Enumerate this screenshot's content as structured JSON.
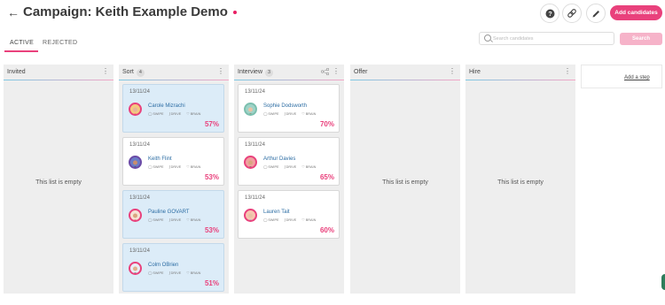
{
  "header": {
    "title": "Campaign: Keith Example Demo",
    "add_candidates_label": "Add candidates",
    "icons": [
      "help-icon",
      "link-icon",
      "edit-icon",
      "back-arrow-icon"
    ]
  },
  "tabs": [
    {
      "label": "ACTIVE",
      "active": true
    },
    {
      "label": "REJECTED",
      "active": false
    }
  ],
  "search": {
    "placeholder": "Search candidates",
    "button_label": "Search"
  },
  "colors": {
    "accent": "#e9417c",
    "link": "#2b6ca3",
    "column_bg": "#eeeeee",
    "card_blue": "#dcecf8"
  },
  "columns": [
    {
      "name": "Invited",
      "count": null,
      "empty_text": "This list is empty",
      "cards": []
    },
    {
      "name": "Sort",
      "count": "4",
      "empty_text": "",
      "cards": [
        {
          "date": "13/11/24",
          "name": "Carole Mizrachi",
          "tags": [
            "SWIPE",
            "DRIVE",
            "BRAIN"
          ],
          "score": "57%",
          "style": "blue"
        },
        {
          "date": "13/11/24",
          "name": "Keith Flint",
          "tags": [
            "SWIPE",
            "DRIVE",
            "BRAIN"
          ],
          "score": "53%",
          "style": "white"
        },
        {
          "date": "13/11/24",
          "name": "Pauline GOVART",
          "tags": [
            "SWIPE",
            "DRIVE",
            "BRAIN"
          ],
          "score": "53%",
          "style": "blue"
        },
        {
          "date": "13/11/24",
          "name": "Colm OBrien",
          "tags": [
            "SWIPE",
            "DRIVE",
            "BRAIN"
          ],
          "score": "51%",
          "style": "blue"
        }
      ]
    },
    {
      "name": "Interview",
      "count": "3",
      "empty_text": "",
      "cards": [
        {
          "date": "13/11/24",
          "name": "Sophie Dodsworth",
          "tags": [
            "SWIPE",
            "DRIVE",
            "BRAIN"
          ],
          "score": "70%",
          "style": "white"
        },
        {
          "date": "13/11/24",
          "name": "Arthur Davies",
          "tags": [
            "SWIPE",
            "DRIVE",
            "BRAIN"
          ],
          "score": "65%",
          "style": "white"
        },
        {
          "date": "13/11/24",
          "name": "Lauren Tait",
          "tags": [
            "SWIPE",
            "DRIVE",
            "BRAIN"
          ],
          "score": "60%",
          "style": "white"
        }
      ]
    },
    {
      "name": "Offer",
      "count": null,
      "empty_text": "This list is empty",
      "cards": []
    },
    {
      "name": "Hire",
      "count": null,
      "empty_text": "This list is empty",
      "cards": []
    }
  ],
  "add_step_label": "Add a step"
}
